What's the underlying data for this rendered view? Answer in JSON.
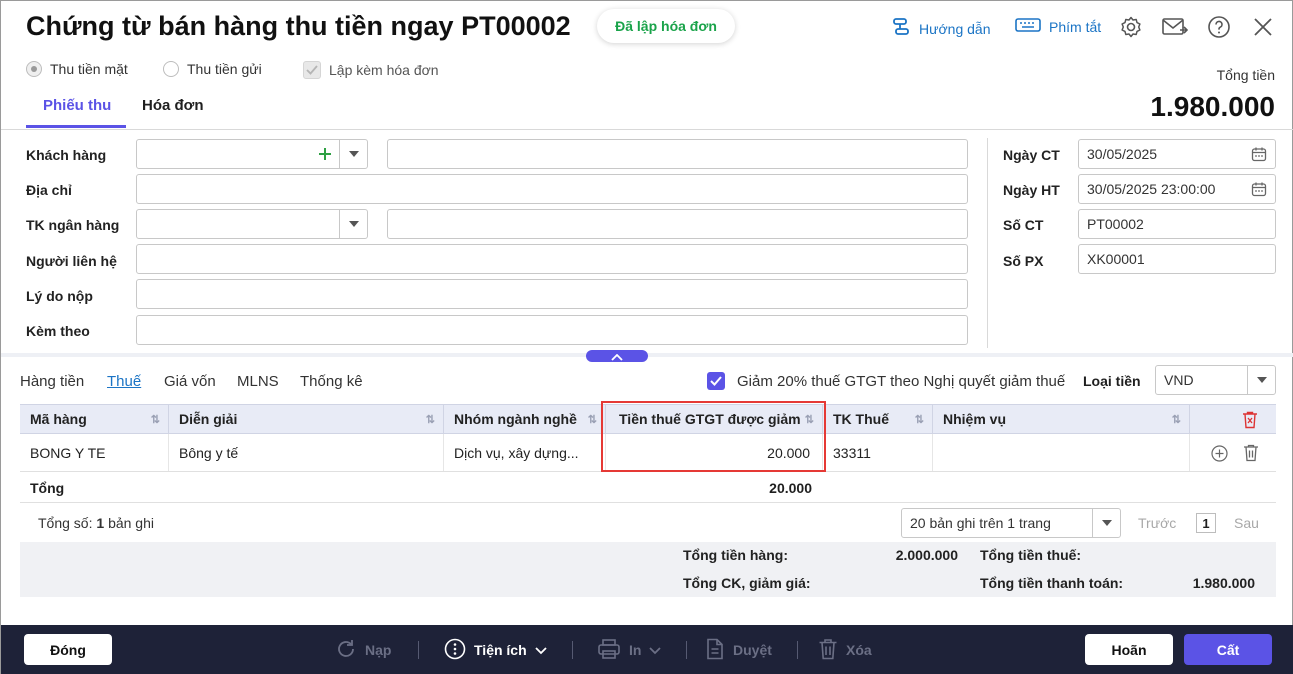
{
  "header": {
    "title": "Chứng từ bán hàng thu tiền ngay PT00002",
    "status": "Đã lập hóa đơn",
    "guide_label": "Hướng dẫn",
    "shortcut_label": "Phím tắt"
  },
  "options": {
    "cash": "Thu tiền mặt",
    "bank": "Thu tiền gửi",
    "invoice": "Lập kèm hóa đơn"
  },
  "tabs": [
    "Phiếu thu",
    "Hóa đơn"
  ],
  "total": {
    "label": "Tổng tiền",
    "value": "1.980.000"
  },
  "form": {
    "customer_label": "Khách hàng",
    "address_label": "Địa chỉ",
    "bank_account_label": "TK ngân hàng",
    "contact_label": "Người liên hệ",
    "reason_label": "Lý do nộp",
    "attach_label": "Kèm theo",
    "date_ct_label": "Ngày CT",
    "date_ct_value": "30/05/2025",
    "date_ht_label": "Ngày HT",
    "date_ht_value": "30/05/2025 23:00:00",
    "so_ct_label": "Số CT",
    "so_ct_value": "PT00002",
    "so_px_label": "Số PX",
    "so_px_value": "XK00001"
  },
  "subtabs": [
    "Hàng tiền",
    "Thuế",
    "Giá vốn",
    "MLNS",
    "Thống kê"
  ],
  "tax_reduction_label": "Giảm 20% thuế GTGT theo Nghị quyết giảm thuế",
  "currency": {
    "label": "Loại tiền",
    "value": "VND"
  },
  "table": {
    "columns": [
      "Mã hàng",
      "Diễn giải",
      "Nhóm ngành nghề",
      "Tiền thuế GTGT được giảm",
      "TK Thuế",
      "Nhiệm vụ"
    ],
    "rows": [
      [
        "BONG Y TE",
        "Bông y tế",
        "Dịch vụ, xây dựng...",
        "20.000",
        "33311",
        ""
      ]
    ],
    "total_label": "Tổng",
    "total_value": "20.000"
  },
  "pager": {
    "count_prefix": "Tổng số:",
    "count": "1",
    "count_suffix": "bản ghi",
    "page_size": "20 bản ghi trên 1 trang",
    "prev": "Trước",
    "page": "1",
    "next": "Sau"
  },
  "summary": {
    "goods_label": "Tổng tiền hàng:",
    "goods_value": "2.000.000",
    "discount_label": "Tổng CK, giảm giá:",
    "tax_label": "Tổng tiền thuế:",
    "pay_label": "Tổng tiền thanh toán:",
    "pay_value": "1.980.000"
  },
  "footer": {
    "close": "Đóng",
    "reload": "Nạp",
    "utility": "Tiện ích",
    "print": "In",
    "approve": "Duyệt",
    "delete": "Xóa",
    "undo": "Hoãn",
    "save": "Cất"
  },
  "colors": {
    "accent": "#5b53e6",
    "link": "#1b74c5",
    "status": "#1aa34a",
    "footer_bg": "#1e2238",
    "highlight": "#e53935"
  }
}
